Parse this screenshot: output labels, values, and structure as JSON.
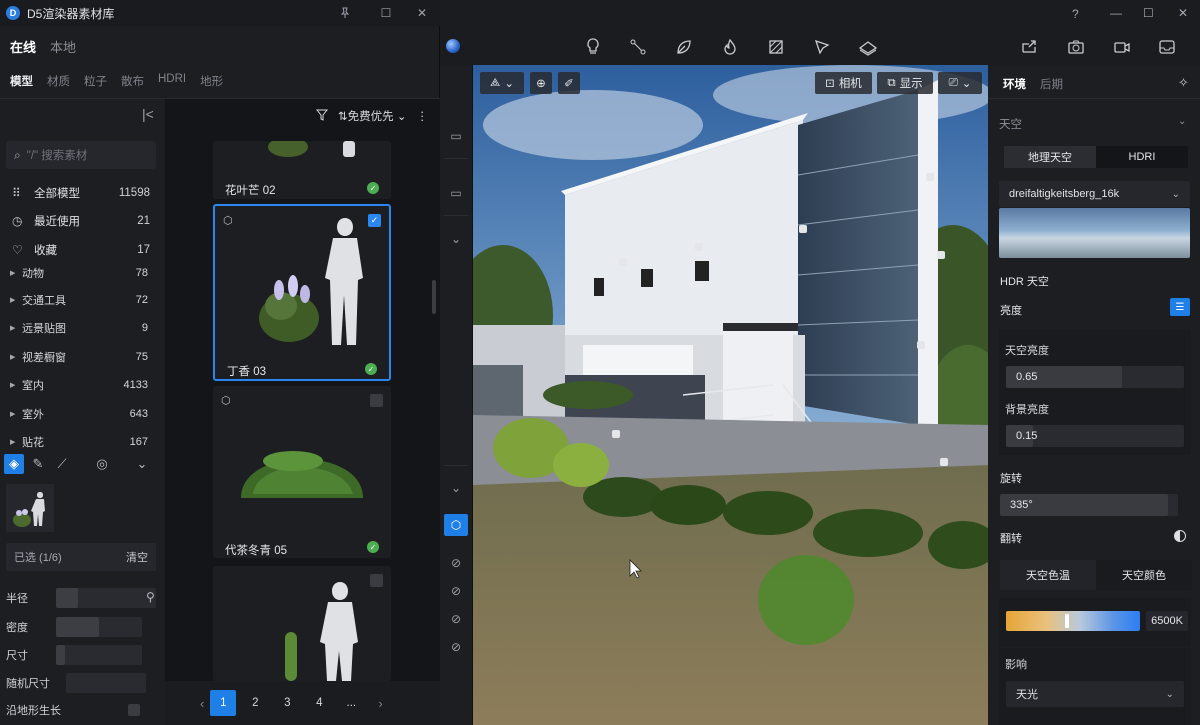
{
  "library": {
    "title": "D5渲染器素材库",
    "tabs_top": [
      {
        "label": "在线"
      },
      {
        "label": "本地"
      }
    ],
    "tabs_sub": [
      {
        "label": "模型"
      },
      {
        "label": "材质"
      },
      {
        "label": "粒子"
      },
      {
        "label": "散布"
      },
      {
        "label": "HDRI"
      },
      {
        "label": "地形"
      }
    ],
    "search_placeholder": "\"/\" 搜索素材",
    "categories": [
      {
        "label": "全部模型",
        "count": "11598",
        "icon": "grid-dots-icon"
      },
      {
        "label": "最近使用",
        "count": "21",
        "icon": "clock-icon"
      },
      {
        "label": "收藏",
        "count": "17",
        "icon": "heart-icon"
      }
    ],
    "subcategories": [
      {
        "label": "动物",
        "count": "78"
      },
      {
        "label": "交通工具",
        "count": "72"
      },
      {
        "label": "远景贴图",
        "count": "9"
      },
      {
        "label": "视差橱窗",
        "count": "75"
      },
      {
        "label": "室内",
        "count": "4133"
      },
      {
        "label": "室外",
        "count": "643"
      },
      {
        "label": "贴花",
        "count": "167"
      }
    ],
    "filter_label": "免费优先",
    "selected_label": "已选 (1/6)",
    "clear_label": "清空",
    "brush_props": [
      {
        "label": "半径",
        "value": 0.22
      },
      {
        "label": "密度",
        "value": 0.5
      },
      {
        "label": "尺寸",
        "value": 0.1
      },
      {
        "label": "随机尺寸",
        "value": 0
      },
      {
        "label": "沿地形生长",
        "value": 0
      }
    ],
    "assets": [
      {
        "name": "花叶芒 02",
        "downloaded": true,
        "selected": false
      },
      {
        "name": "丁香 03",
        "downloaded": true,
        "selected": true
      },
      {
        "name": "代茶冬青 05",
        "downloaded": true,
        "selected": false
      },
      {
        "name": "",
        "downloaded": false,
        "selected": false
      }
    ],
    "pagination": {
      "pages": [
        "1",
        "2",
        "3",
        "4",
        "..."
      ],
      "current": "1"
    }
  },
  "viewport": {
    "camera_label": "相机",
    "display_label": "显示"
  },
  "env_panel": {
    "tabs": [
      {
        "label": "环境"
      },
      {
        "label": "后期"
      }
    ],
    "section_title": "天空",
    "sky_modes": [
      {
        "label": "地理天空"
      },
      {
        "label": "HDRI"
      }
    ],
    "hdri_name": "dreifaltigkeitsberg_16k",
    "hdr_sky_label": "HDR 天空",
    "brightness_label": "亮度",
    "sky_brightness_label": "天空亮度",
    "sky_brightness_value": "0.65",
    "bg_brightness_label": "背景亮度",
    "bg_brightness_value": "0.15",
    "rotation_label": "旋转",
    "rotation_value": "335°",
    "flip_label": "翻转",
    "color_modes": [
      {
        "label": "天空色温"
      },
      {
        "label": "天空颜色"
      }
    ],
    "temp_value": "6500K",
    "temp_fraction": 0.45,
    "influence_label": "影响",
    "influence_value": "天光"
  }
}
